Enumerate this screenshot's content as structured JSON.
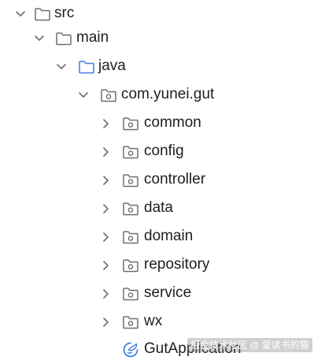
{
  "tree": {
    "items": [
      {
        "label": "src",
        "expanded": true,
        "icon": "folder-icon"
      },
      {
        "label": "main",
        "expanded": true,
        "icon": "folder-icon"
      },
      {
        "label": "java",
        "expanded": true,
        "icon": "source-folder-icon"
      },
      {
        "label": "com.yunei.gut",
        "expanded": true,
        "icon": "package-icon"
      },
      {
        "label": "common",
        "expanded": false,
        "icon": "package-icon"
      },
      {
        "label": "config",
        "expanded": false,
        "icon": "package-icon"
      },
      {
        "label": "controller",
        "expanded": false,
        "icon": "package-icon"
      },
      {
        "label": "data",
        "expanded": false,
        "icon": "package-icon"
      },
      {
        "label": "domain",
        "expanded": false,
        "icon": "package-icon"
      },
      {
        "label": "repository",
        "expanded": false,
        "icon": "package-icon"
      },
      {
        "label": "service",
        "expanded": false,
        "icon": "package-icon"
      },
      {
        "label": "wx",
        "expanded": false,
        "icon": "package-icon"
      },
      {
        "label": "GutApplication",
        "icon": "spring-boot-class-icon"
      }
    ]
  },
  "watermark": "掘金技术社区 @ 爱读书的猫",
  "colors": {
    "folder": "#6e6e73",
    "source_folder": "#3d7ae6",
    "spring": "#3d7ae6",
    "chevron": "#6e6e73"
  }
}
